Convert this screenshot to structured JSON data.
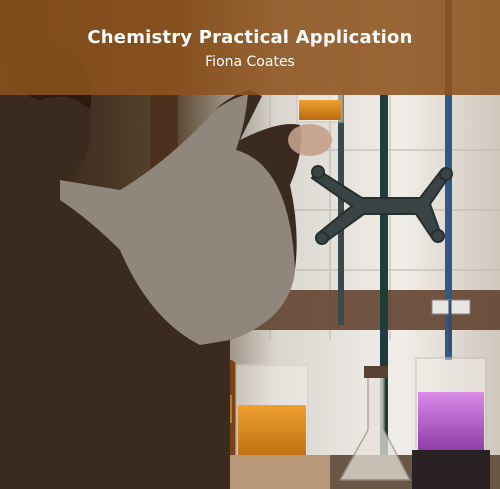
{
  "cover": {
    "title": "Chemistry Practical Application",
    "author": "Fiona Coates"
  },
  "colors": {
    "banner": "#8c521c",
    "title_text": "#ffffff",
    "author_text": "#ffffff"
  }
}
